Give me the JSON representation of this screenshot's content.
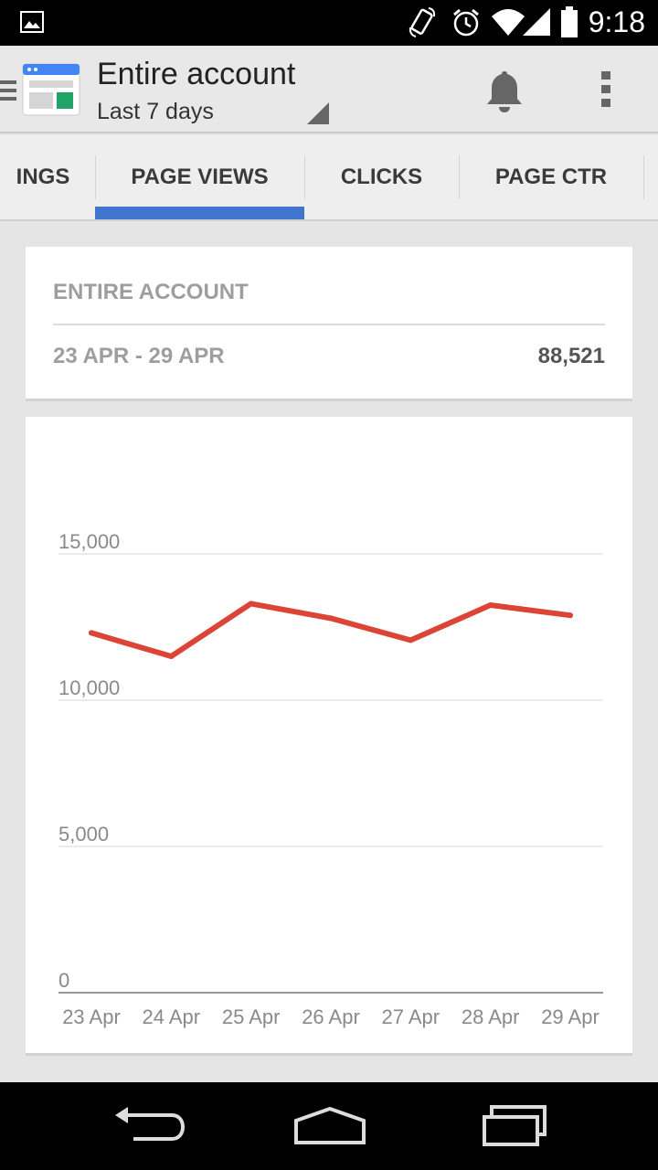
{
  "status_bar": {
    "time": "9:18",
    "icons": [
      "gallery-icon",
      "rotate-icon",
      "alarm-icon",
      "wifi-icon",
      "signal-icon",
      "battery-icon"
    ]
  },
  "action_bar": {
    "title": "Entire account",
    "subtitle": "Last 7 days",
    "icons": [
      "drawer-icon",
      "adsense-app-icon",
      "notification-bell-icon",
      "overflow-menu-icon"
    ]
  },
  "tabs": [
    {
      "label": "INGS",
      "selected": false
    },
    {
      "label": "PAGE VIEWS",
      "selected": true
    },
    {
      "label": "CLICKS",
      "selected": false
    },
    {
      "label": "PAGE CTR",
      "selected": false
    }
  ],
  "summary": {
    "title": "ENTIRE ACCOUNT",
    "range": "23 APR - 29 APR",
    "total": "88,521"
  },
  "colors": {
    "accent_tab": "#3f75cc",
    "line": "#db4437",
    "background": "#e5e5e5"
  },
  "chart_data": {
    "type": "line",
    "x": [
      "23 Apr",
      "24 Apr",
      "25 Apr",
      "26 Apr",
      "27 Apr",
      "28 Apr",
      "29 Apr"
    ],
    "series": [
      {
        "values": [
          12300,
          11500,
          13300,
          12800,
          12050,
          13250,
          12900
        ]
      }
    ],
    "yticks": [
      "0",
      "5,000",
      "10,000",
      "15,000"
    ],
    "ylim": [
      0,
      15000
    ],
    "grid": true
  },
  "nav_bar": {
    "icons": [
      "back-icon",
      "home-icon",
      "recents-icon"
    ]
  }
}
